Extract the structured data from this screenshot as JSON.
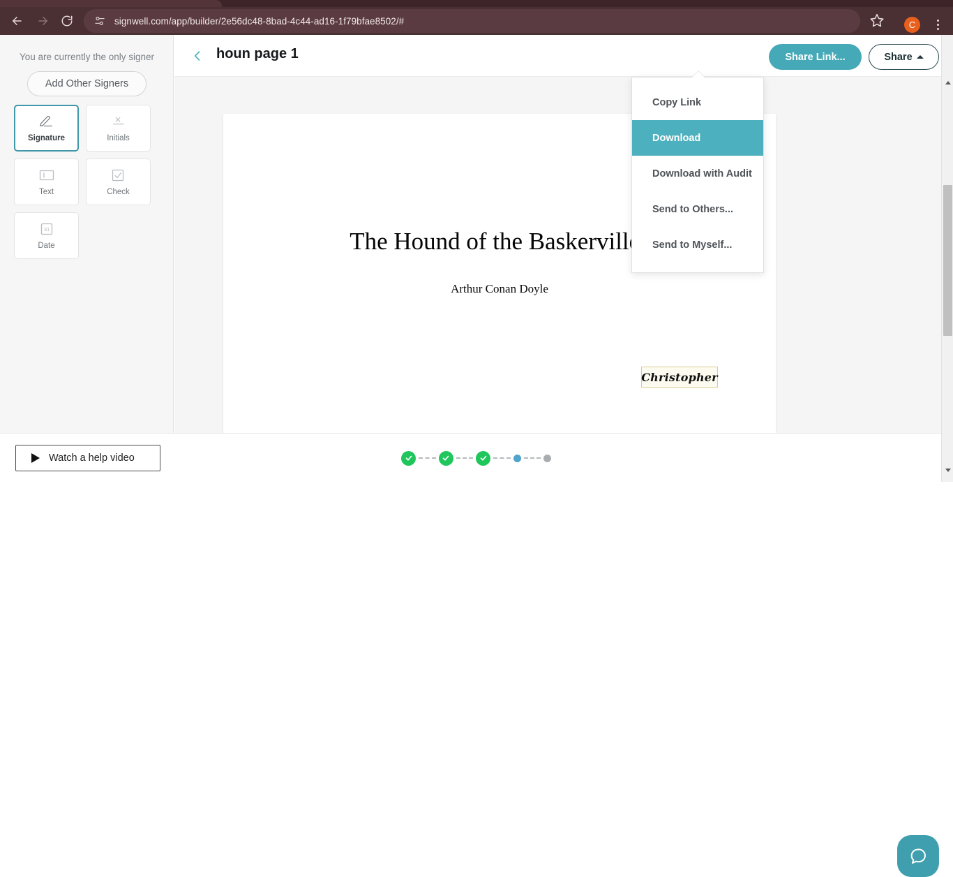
{
  "browser": {
    "url": "signwell.com/app/builder/2e56dc48-8bad-4c44-ad16-1f79bfae8502/#",
    "back_icon": "back-arrow-icon",
    "forward_icon": "forward-arrow-icon",
    "reload_icon": "reload-icon",
    "site_settings_icon": "site-settings-icon",
    "bookmark_icon": "star-icon",
    "profile_initial": "C",
    "profile_color": "#e8601c",
    "menu_icon": "three-dot-menu-icon"
  },
  "sidebar": {
    "signer_note": "You are currently the only signer",
    "add_signers_label": "Add Other Signers",
    "tiles": [
      {
        "label": "Signature",
        "icon": "pen-signature-icon",
        "selected": true
      },
      {
        "label": "Initials",
        "icon": "initials-x-icon",
        "selected": false
      },
      {
        "label": "Text",
        "icon": "text-cursor-icon",
        "selected": false
      },
      {
        "label": "Check",
        "icon": "checkbox-icon",
        "selected": false
      },
      {
        "label": "Date",
        "icon": "calendar-31-icon",
        "selected": false
      }
    ]
  },
  "doc_header": {
    "back_icon": "chevron-left-icon",
    "title": "houn page 1",
    "share_link_label": "Share Link...",
    "share_label": "Share",
    "share_caret_icon": "caret-up-icon"
  },
  "share_menu": {
    "items": [
      {
        "label": "Copy Link",
        "active": false
      },
      {
        "label": "Download",
        "active": true
      },
      {
        "label": "Download with Audit",
        "active": false
      },
      {
        "label": "Send to Others...",
        "active": false
      },
      {
        "label": "Send to Myself...",
        "active": false
      }
    ],
    "highlight_color": "#4db0be"
  },
  "document": {
    "title": "The Hound of the Baskervilles",
    "author": "Arthur Conan Doyle",
    "signature_field_value": "Christopher"
  },
  "footer": {
    "help_video_label": "Watch a help video",
    "play_icon": "play-triangle-icon",
    "help_bubble_icon": "chat-bubble-icon",
    "steps": [
      {
        "state": "done"
      },
      {
        "state": "done"
      },
      {
        "state": "done"
      },
      {
        "state": "current"
      },
      {
        "state": "pending"
      }
    ],
    "done_color": "#1fc65c",
    "current_color": "#50a3cb",
    "pending_color": "#a9adb0"
  },
  "scrollbar": {
    "up_icon": "scroll-up-arrow-icon",
    "down_icon": "scroll-down-arrow-icon"
  },
  "theme": {
    "accent_teal": "#46a9b7",
    "chrome_bg": "#4a2f33"
  }
}
